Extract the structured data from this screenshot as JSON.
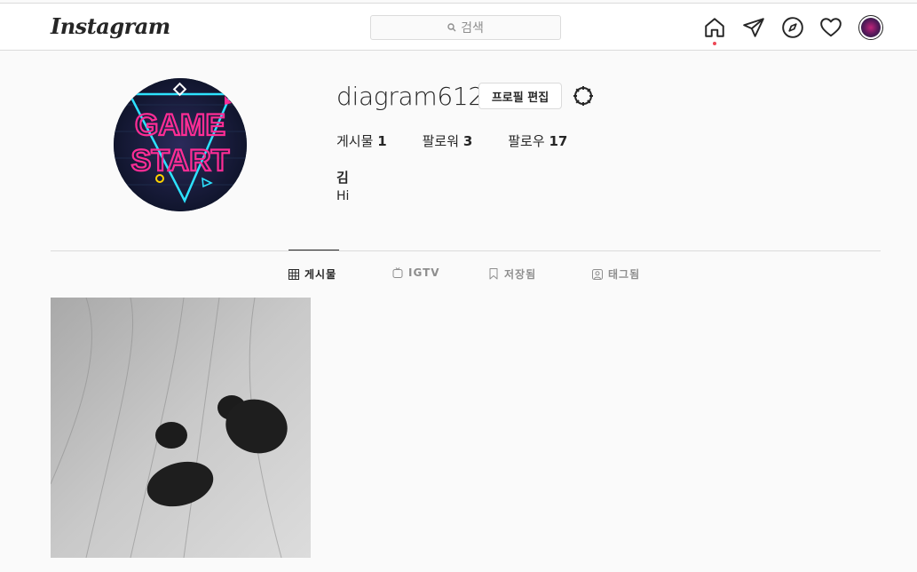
{
  "header": {
    "logo": "Instagram",
    "search_placeholder": "검색",
    "nav_icons": [
      "home-icon",
      "direct-icon",
      "explore-icon",
      "activity-icon",
      "profile-avatar"
    ]
  },
  "profile": {
    "username": "diagram612",
    "edit_label": "프로필 편집",
    "stats": [
      {
        "label": "게시물",
        "count": "1"
      },
      {
        "label": "팔로워",
        "count": "3"
      },
      {
        "label": "팔로우",
        "count": "17"
      }
    ],
    "full_name": "김",
    "bio": "Hi",
    "avatar_text": [
      "GAME",
      "START"
    ]
  },
  "tabs": [
    {
      "label": "게시물",
      "icon": "grid-icon",
      "active": true
    },
    {
      "label": "IGTV",
      "icon": "igtv-icon",
      "active": false
    },
    {
      "label": "저장됨",
      "icon": "bookmark-icon",
      "active": false
    },
    {
      "label": "태그됨",
      "icon": "tagged-icon",
      "active": false
    }
  ],
  "colors": {
    "notification_dot": "#ed4956",
    "neon_pink": "#ff2d95",
    "neon_cyan": "#2de2ff"
  }
}
